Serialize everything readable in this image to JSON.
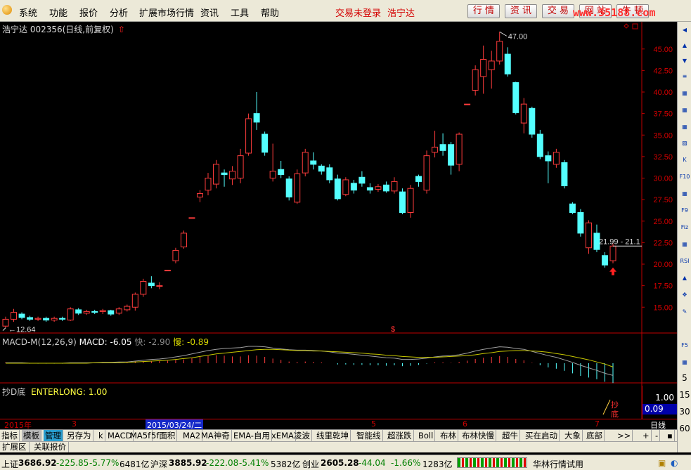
{
  "menubar": {
    "items": [
      "系统",
      "功能",
      "报价",
      "分析",
      "扩展市场行情",
      "资讯",
      "工具",
      "帮助"
    ],
    "trade_status": "交易未登录",
    "stock_name": "浩宁达",
    "buttons": [
      "行 情",
      "资 讯",
      "交 易",
      "网 站",
      "牛 顿"
    ],
    "watermark": "www.55188.com"
  },
  "chart_title": {
    "stock": "浩宁达 002356(日线,前复权)",
    "arrow": "⇧"
  },
  "main_chart": {
    "y_ticks": [
      "45.00",
      "42.50",
      "40.00",
      "37.50",
      "35.00",
      "32.50",
      "30.00",
      "27.50",
      "25.00",
      "22.50",
      "20.00",
      "17.50",
      "15.00"
    ],
    "high_label": "47.00",
    "low_label": "12.64",
    "current_label": "21.99 - 21.1",
    "dollar_marker": "$"
  },
  "macd": {
    "name": "MACD-M(12,26,9)",
    "macd_label": "MACD: -6.05",
    "fast_label": "快: -2.90",
    "slow_label": "慢: -0.89"
  },
  "dl_indicator": {
    "name": "抄D底",
    "value_label": "ENTERLONG: 1.00",
    "scale_top": "1.00",
    "current_value": "0.09",
    "signal_text": "抄底"
  },
  "xaxis": {
    "year": "2015年",
    "labels": [
      "3",
      "4",
      "5",
      "6",
      "7"
    ],
    "cursor_date": "2015/03/24/二",
    "period": "日线"
  },
  "tabs": [
    "指标",
    "模板",
    "管理",
    "另存为",
    "k",
    "MACD",
    "MA5f",
    "5f面积",
    "MA2",
    "MA神奇",
    "EMA-自用",
    "xEMA",
    "凌波",
    "线里乾坤",
    "智能线",
    "超涨跌",
    "Boll",
    "布林",
    "布林快慢",
    "超牛",
    "买在启动",
    "大象",
    "底部",
    ">>",
    "+",
    "-",
    "▪"
  ],
  "subtabs": [
    "扩展区",
    "关联报价"
  ],
  "statusbar": {
    "sh_name": "上证",
    "sh_value": "3686.92",
    "sh_change": "-225.85",
    "sh_pct": "-5.77%",
    "sh_vol": "6481亿",
    "sz_name": "沪深",
    "sz_value": "3885.92",
    "sz_change": "-222.08",
    "sz_pct": "-5.41%",
    "sz_vol": "5382亿",
    "cy_name": "创业",
    "cy_value": "2605.28",
    "cy_change": "-44.04",
    "cy_pct": "-1.66%",
    "cy_vol": "1283亿",
    "broker": "华林行情试用"
  },
  "right_toolbar": [
    "◀",
    "▲",
    "▼",
    "≡",
    "▦",
    "▦",
    "▦",
    "▨",
    "K",
    "▦",
    "F10",
    "▦",
    "F9",
    "Fiz",
    "▦",
    "RSI",
    "▲",
    "✥",
    "✎",
    "F5",
    "▦"
  ],
  "right_numbers": [
    "5",
    "15",
    "30",
    "60"
  ],
  "chart_data": {
    "type": "candlestick",
    "ylim": [
      12.0,
      48.0
    ],
    "candles": [
      {
        "o": 12.8,
        "c": 13.6,
        "h": 13.9,
        "l": 12.6
      },
      {
        "o": 13.6,
        "c": 14.4,
        "h": 14.8,
        "l": 13.3
      },
      {
        "o": 14.2,
        "c": 13.8,
        "h": 14.4,
        "l": 13.6
      },
      {
        "o": 13.8,
        "c": 13.6,
        "h": 14.0,
        "l": 13.4
      },
      {
        "o": 13.6,
        "c": 13.7,
        "h": 13.9,
        "l": 13.4
      },
      {
        "o": 13.7,
        "c": 13.5,
        "h": 13.9,
        "l": 13.3
      },
      {
        "o": 13.5,
        "c": 13.7,
        "h": 13.9,
        "l": 13.3
      },
      {
        "o": 13.7,
        "c": 13.6,
        "h": 13.9,
        "l": 13.4
      },
      {
        "o": 13.5,
        "c": 14.8,
        "h": 15.0,
        "l": 13.4
      },
      {
        "o": 14.7,
        "c": 14.3,
        "h": 14.9,
        "l": 14.1
      },
      {
        "o": 14.3,
        "c": 14.5,
        "h": 14.7,
        "l": 14.1
      },
      {
        "o": 14.5,
        "c": 14.4,
        "h": 14.7,
        "l": 14.2
      },
      {
        "o": 14.5,
        "c": 14.6,
        "h": 14.8,
        "l": 14.2
      },
      {
        "o": 14.6,
        "c": 14.2,
        "h": 14.7,
        "l": 14.0
      },
      {
        "o": 14.3,
        "c": 14.8,
        "h": 15.0,
        "l": 14.1
      },
      {
        "o": 14.7,
        "c": 15.1,
        "h": 15.3,
        "l": 14.5
      },
      {
        "o": 15.0,
        "c": 16.5,
        "h": 16.7,
        "l": 14.6
      },
      {
        "o": 16.5,
        "c": 18.0,
        "h": 18.3,
        "l": 16.2
      },
      {
        "o": 17.8,
        "c": 17.5,
        "h": 18.6,
        "l": 17.2
      },
      {
        "o": 17.5,
        "c": 17.5,
        "h": 17.9,
        "l": 17.1
      },
      {
        "o": 19.3,
        "c": 19.3,
        "h": 19.3,
        "l": 19.3
      },
      {
        "o": 20.4,
        "c": 21.6,
        "h": 21.9,
        "l": 20.1
      },
      {
        "o": 22.0,
        "c": 23.6,
        "h": 23.9,
        "l": 21.8
      },
      {
        "o": 25.4,
        "c": 25.4,
        "h": 25.4,
        "l": 25.4
      },
      {
        "o": 27.8,
        "c": 28.2,
        "h": 28.6,
        "l": 27.2
      },
      {
        "o": 28.6,
        "c": 30.0,
        "h": 30.6,
        "l": 28.0
      },
      {
        "o": 29.3,
        "c": 31.6,
        "h": 32.1,
        "l": 28.8
      },
      {
        "o": 30.6,
        "c": 30.4,
        "h": 31.0,
        "l": 29.0
      },
      {
        "o": 29.9,
        "c": 30.8,
        "h": 31.4,
        "l": 29.2
      },
      {
        "o": 30.0,
        "c": 32.6,
        "h": 33.4,
        "l": 29.4
      },
      {
        "o": 32.9,
        "c": 36.9,
        "h": 37.5,
        "l": 32.6
      },
      {
        "o": 37.5,
        "c": 36.5,
        "h": 40.0,
        "l": 35.6
      },
      {
        "o": 35.1,
        "c": 33.0,
        "h": 35.4,
        "l": 32.6
      },
      {
        "o": 30.0,
        "c": 30.8,
        "h": 34.0,
        "l": 29.6
      },
      {
        "o": 31.0,
        "c": 30.4,
        "h": 32.0,
        "l": 30.0
      },
      {
        "o": 29.9,
        "c": 27.8,
        "h": 30.2,
        "l": 27.4
      },
      {
        "o": 27.2,
        "c": 30.5,
        "h": 31.0,
        "l": 27.0
      },
      {
        "o": 30.6,
        "c": 33.0,
        "h": 33.4,
        "l": 30.2
      },
      {
        "o": 32.0,
        "c": 31.6,
        "h": 33.0,
        "l": 31.0
      },
      {
        "o": 31.4,
        "c": 30.8,
        "h": 31.6,
        "l": 30.4
      },
      {
        "o": 31.2,
        "c": 29.8,
        "h": 31.6,
        "l": 29.4
      },
      {
        "o": 29.9,
        "c": 27.6,
        "h": 30.4,
        "l": 27.4
      },
      {
        "o": 28.1,
        "c": 29.8,
        "h": 30.1,
        "l": 27.9
      },
      {
        "o": 29.4,
        "c": 28.6,
        "h": 29.8,
        "l": 28.2
      },
      {
        "o": 30.1,
        "c": 29.4,
        "h": 30.8,
        "l": 29.0
      },
      {
        "o": 28.9,
        "c": 28.6,
        "h": 29.4,
        "l": 28.2
      },
      {
        "o": 28.7,
        "c": 29.0,
        "h": 29.3,
        "l": 28.4
      },
      {
        "o": 29.2,
        "c": 28.5,
        "h": 29.6,
        "l": 28.3
      },
      {
        "o": 28.5,
        "c": 29.6,
        "h": 30.1,
        "l": 28.2
      },
      {
        "o": 28.4,
        "c": 26.0,
        "h": 28.8,
        "l": 25.8
      },
      {
        "o": 26.0,
        "c": 28.8,
        "h": 29.2,
        "l": 25.4
      },
      {
        "o": 30.2,
        "c": 29.6,
        "h": 30.4,
        "l": 29.0
      },
      {
        "o": 28.6,
        "c": 32.6,
        "h": 33.2,
        "l": 28.2
      },
      {
        "o": 33.0,
        "c": 33.6,
        "h": 35.5,
        "l": 32.4
      },
      {
        "o": 33.9,
        "c": 33.2,
        "h": 35.2,
        "l": 32.6
      },
      {
        "o": 33.9,
        "c": 31.5,
        "h": 34.2,
        "l": 30.4
      },
      {
        "o": 31.6,
        "c": 35.1,
        "h": 35.3,
        "l": 30.8
      },
      {
        "o": 38.6,
        "c": 38.6,
        "h": 38.6,
        "l": 38.6
      },
      {
        "o": 40.2,
        "c": 42.6,
        "h": 43.1,
        "l": 39.6
      },
      {
        "o": 41.8,
        "c": 43.8,
        "h": 45.4,
        "l": 39.8
      },
      {
        "o": 42.6,
        "c": 43.6,
        "h": 44.8,
        "l": 40.4
      },
      {
        "o": 43.6,
        "c": 45.9,
        "h": 47.0,
        "l": 43.2
      },
      {
        "o": 44.4,
        "c": 42.1,
        "h": 45.2,
        "l": 41.8
      },
      {
        "o": 41.1,
        "c": 37.6,
        "h": 41.2,
        "l": 37.4
      },
      {
        "o": 36.4,
        "c": 38.6,
        "h": 39.3,
        "l": 35.2
      },
      {
        "o": 38.1,
        "c": 35.1,
        "h": 38.3,
        "l": 34.7
      },
      {
        "o": 35.1,
        "c": 32.5,
        "h": 35.6,
        "l": 32.2
      },
      {
        "o": 32.6,
        "c": 32.0,
        "h": 33.1,
        "l": 29.4
      },
      {
        "o": 31.6,
        "c": 33.0,
        "h": 33.4,
        "l": 31.2
      },
      {
        "o": 31.8,
        "c": 29.1,
        "h": 32.1,
        "l": 28.8
      },
      {
        "o": 27.0,
        "c": 26.0,
        "h": 27.2,
        "l": 25.8
      },
      {
        "o": 26.0,
        "c": 23.6,
        "h": 26.4,
        "l": 23.2
      },
      {
        "o": 21.9,
        "c": 24.8,
        "h": 25.1,
        "l": 21.2
      },
      {
        "o": 23.6,
        "c": 21.7,
        "h": 24.6,
        "l": 21.4
      },
      {
        "o": 21.0,
        "c": 19.9,
        "h": 21.4,
        "l": 19.6
      },
      {
        "o": 20.4,
        "c": 22.1,
        "h": 22.4,
        "l": 20.1
      }
    ],
    "macd_hist": [
      0.2,
      0.1,
      0.0,
      -0.1,
      -0.1,
      -0.1,
      -0.1,
      -0.1,
      0.1,
      0.1,
      0.1,
      0.1,
      0.1,
      0.1,
      0.2,
      0.2,
      0.4,
      0.5,
      0.5,
      0.5,
      0.6,
      0.8,
      0.9,
      1.2,
      1.5,
      1.7,
      1.9,
      1.8,
      1.6,
      1.6,
      1.9,
      1.8,
      1.5,
      1.1,
      0.8,
      0.4,
      0.3,
      0.4,
      0.3,
      0.2,
      0.0,
      -0.3,
      -0.3,
      -0.4,
      -0.4,
      -0.5,
      -0.5,
      -0.6,
      -0.5,
      -0.7,
      -0.6,
      -0.4,
      -0.1,
      0.2,
      0.2,
      0.1,
      0.3,
      0.6,
      1.0,
      1.3,
      1.5,
      1.7,
      1.5,
      1.0,
      0.7,
      0.1,
      -0.5,
      -1.0,
      -1.3,
      -1.8,
      -2.4,
      -3.0,
      -3.4,
      -3.8,
      -4.4,
      -4.7
    ],
    "macd_fast": [
      0.1,
      0.1,
      0.1,
      0.0,
      0.0,
      0.0,
      0.0,
      0.0,
      0.1,
      0.1,
      0.1,
      0.1,
      0.2,
      0.2,
      0.3,
      0.3,
      0.5,
      0.7,
      0.9,
      1.0,
      1.2,
      1.5,
      1.8,
      2.2,
      2.6,
      3.0,
      3.3,
      3.5,
      3.6,
      3.7,
      4.0,
      4.0,
      3.9,
      3.6,
      3.4,
      3.2,
      3.1,
      3.1,
      3.0,
      2.9,
      2.7,
      2.4,
      2.3,
      2.1,
      1.9,
      1.7,
      1.5,
      1.3,
      1.2,
      0.9,
      0.9,
      1.0,
      1.2,
      1.5,
      1.7,
      1.8,
      2.0,
      2.4,
      2.9,
      3.3,
      3.6,
      3.9,
      3.8,
      3.5,
      3.3,
      2.8,
      2.3,
      1.8,
      1.4,
      0.8,
      0.2,
      -0.5,
      -1.1,
      -1.7,
      -2.4,
      -2.9
    ],
    "macd_slow": [
      0.0,
      0.0,
      0.0,
      0.0,
      0.0,
      0.0,
      0.0,
      0.0,
      0.0,
      0.0,
      0.0,
      0.1,
      0.1,
      0.1,
      0.1,
      0.2,
      0.3,
      0.4,
      0.5,
      0.6,
      0.7,
      0.9,
      1.1,
      1.3,
      1.6,
      1.9,
      2.2,
      2.4,
      2.6,
      2.8,
      3.0,
      3.2,
      3.3,
      3.3,
      3.2,
      3.1,
      3.0,
      3.0,
      2.9,
      2.9,
      2.8,
      2.7,
      2.6,
      2.5,
      2.4,
      2.2,
      2.1,
      1.9,
      1.8,
      1.6,
      1.5,
      1.4,
      1.4,
      1.4,
      1.5,
      1.6,
      1.7,
      1.8,
      2.0,
      2.3,
      2.5,
      2.8,
      2.9,
      3.0,
      3.0,
      2.9,
      2.8,
      2.6,
      2.3,
      2.0,
      1.6,
      1.2,
      0.8,
      0.3,
      -0.2,
      -0.9
    ]
  }
}
